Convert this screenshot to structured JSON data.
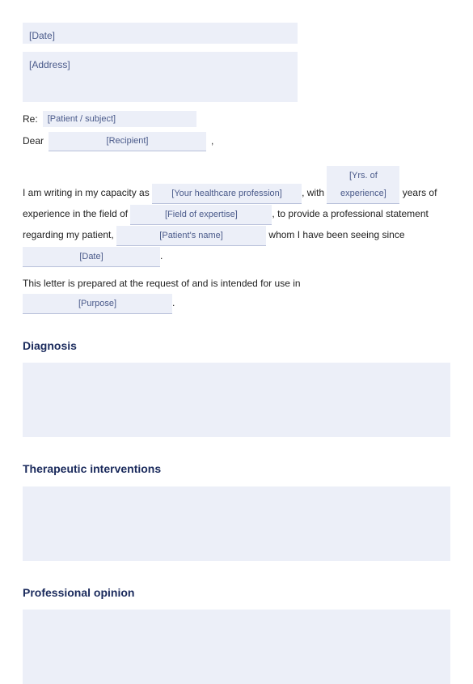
{
  "header": {
    "date_placeholder": "[Date]",
    "address_placeholder": "[Address]"
  },
  "salutation": {
    "re_label": "Re:",
    "re_placeholder": "[Patient / subject]",
    "dear_label": "Dear",
    "recipient_placeholder": "[Recipient]",
    "comma": ","
  },
  "body": {
    "p1_a": "I am writing in my capacity as ",
    "profession_placeholder": "[Your healthcare profession]",
    "p1_b": ", with ",
    "years_placeholder": "[Yrs. of experience]",
    "p1_c": " years of experience in the field of ",
    "field_placeholder": "[Field of expertise]",
    "p1_d": ", to provide a professional statement regarding  my  patient, ",
    "patient_placeholder": "[Patient's name]",
    "p1_e": " whom I have been seeing since ",
    "date2_placeholder": "[Date]",
    "p1_f": ".",
    "p2_a": "This letter is prepared at the request of and is intended for use in ",
    "purpose_placeholder": "[Purpose]",
    "p2_b": "."
  },
  "sections": {
    "diagnosis": "Diagnosis",
    "therapeutic": "Therapeutic interventions",
    "opinion": "Professional opinion"
  }
}
